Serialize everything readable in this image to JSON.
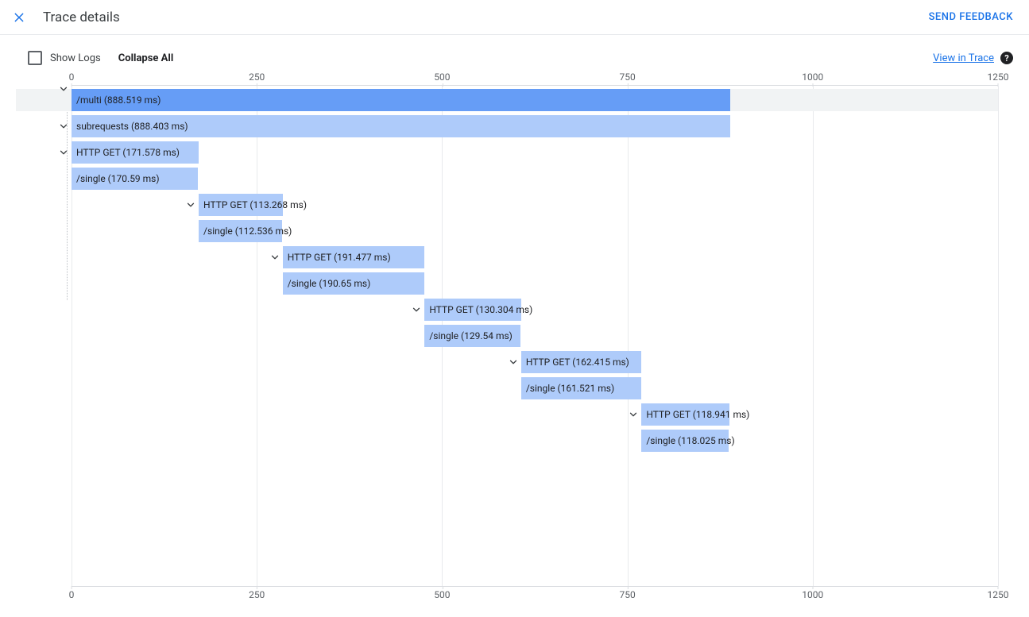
{
  "header": {
    "title": "Trace details",
    "send_feedback": "SEND FEEDBACK"
  },
  "toolbar": {
    "show_logs_label": "Show Logs",
    "collapse_all": "Collapse All",
    "view_in_trace": "View in Trace"
  },
  "chart_data": {
    "type": "bar",
    "xlabel": "",
    "ylabel": "",
    "xlim": [
      0,
      1250
    ],
    "ticks": [
      0,
      250,
      500,
      750,
      1000,
      1250
    ],
    "unit": "ms",
    "spans": [
      {
        "name": "/multi",
        "duration_ms": 888.519,
        "start_ms": 0,
        "selected": true,
        "expandable": true
      },
      {
        "name": "subrequests",
        "duration_ms": 888.403,
        "start_ms": 0,
        "selected": false,
        "expandable": true
      },
      {
        "name": "HTTP GET",
        "duration_ms": 171.578,
        "start_ms": 0,
        "selected": false,
        "expandable": true
      },
      {
        "name": "/single",
        "duration_ms": 170.59,
        "start_ms": 0,
        "selected": false,
        "expandable": false
      },
      {
        "name": "HTTP GET",
        "duration_ms": 113.268,
        "start_ms": 171.578,
        "selected": false,
        "expandable": true
      },
      {
        "name": "/single",
        "duration_ms": 112.536,
        "start_ms": 171.578,
        "selected": false,
        "expandable": false
      },
      {
        "name": "HTTP GET",
        "duration_ms": 191.477,
        "start_ms": 284.846,
        "selected": false,
        "expandable": true
      },
      {
        "name": "/single",
        "duration_ms": 190.65,
        "start_ms": 284.846,
        "selected": false,
        "expandable": false
      },
      {
        "name": "HTTP GET",
        "duration_ms": 130.304,
        "start_ms": 476.323,
        "selected": false,
        "expandable": true
      },
      {
        "name": "/single",
        "duration_ms": 129.54,
        "start_ms": 476.323,
        "selected": false,
        "expandable": false
      },
      {
        "name": "HTTP GET",
        "duration_ms": 162.415,
        "start_ms": 606.627,
        "selected": false,
        "expandable": true
      },
      {
        "name": "/single",
        "duration_ms": 161.521,
        "start_ms": 606.627,
        "selected": false,
        "expandable": false
      },
      {
        "name": "HTTP GET",
        "duration_ms": 118.941,
        "start_ms": 769.042,
        "selected": false,
        "expandable": true
      },
      {
        "name": "/single",
        "duration_ms": 118.025,
        "start_ms": 769.042,
        "selected": false,
        "expandable": false
      }
    ]
  }
}
